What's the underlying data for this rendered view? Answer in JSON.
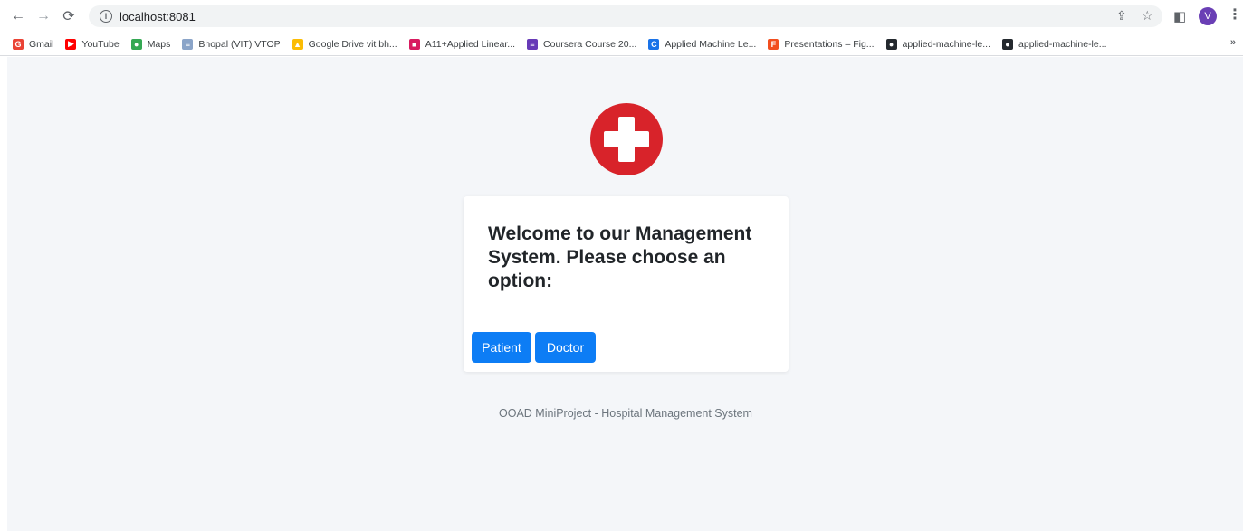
{
  "browser": {
    "url": "localhost:8081",
    "profile_initial": "V",
    "bookmarks": [
      {
        "label": "Gmail",
        "icon": "gmail-icon",
        "color": "#ea4335",
        "glyph": "G"
      },
      {
        "label": "YouTube",
        "icon": "youtube-icon",
        "color": "#ff0000",
        "glyph": "▶"
      },
      {
        "label": "Maps",
        "icon": "maps-icon",
        "color": "#34a853",
        "glyph": "●"
      },
      {
        "label": "Bhopal (VIT) VTOP",
        "icon": "vtop-icon",
        "color": "#8aa4c8",
        "glyph": "≡"
      },
      {
        "label": "Google Drive vit bh...",
        "icon": "drive-icon",
        "color": "#fbbc04",
        "glyph": "▲"
      },
      {
        "label": "A11+Applied Linear...",
        "icon": "classroom-icon",
        "color": "#d81b60",
        "glyph": "■"
      },
      {
        "label": "Coursera Course 20...",
        "icon": "forms-icon",
        "color": "#673ab7",
        "glyph": "≡"
      },
      {
        "label": "Applied Machine Le...",
        "icon": "coursera-icon",
        "color": "#1a73e8",
        "glyph": "C"
      },
      {
        "label": "Presentations – Fig...",
        "icon": "figma-icon",
        "color": "#f24e1e",
        "glyph": "F"
      },
      {
        "label": "applied-machine-le...",
        "icon": "github-icon",
        "color": "#24292e",
        "glyph": "●"
      },
      {
        "label": "applied-machine-le...",
        "icon": "github-icon",
        "color": "#24292e",
        "glyph": "●"
      }
    ],
    "more_label": "»"
  },
  "main": {
    "title": "Welcome to our Management System. Please choose an option:",
    "patient_button": "Patient",
    "doctor_button": "Doctor",
    "footer": "OOAD MiniProject - Hospital Management System"
  },
  "colors": {
    "logo_red": "#d8232a",
    "button_blue": "#0d7df5",
    "page_bg": "#f4f6f9"
  }
}
